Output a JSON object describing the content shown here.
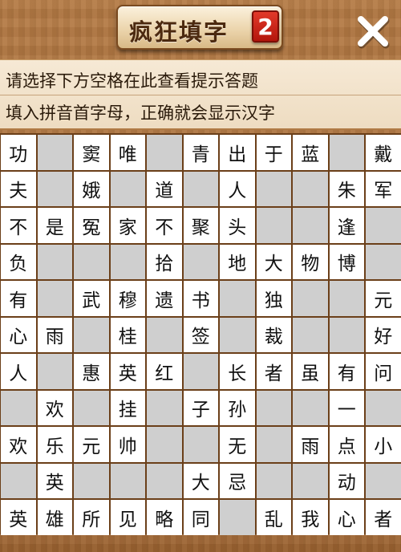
{
  "header": {
    "title": "疯狂填字",
    "level": "2",
    "close_icon": "close-x-icon"
  },
  "hint": {
    "line1": "请选择下方空格在此查看提示答题",
    "line2": "填入拼音首字母，正确就会显示汉字"
  },
  "colors": {
    "wood": "#a76d38",
    "panel": "#f3e4cc",
    "badge": "#d0281a",
    "empty_cell": "#cfcfcf",
    "filled_cell": "#ffffff"
  },
  "grid": {
    "rows": 11,
    "cols": 11,
    "cells": [
      [
        "功",
        "",
        "窦",
        "唯",
        "",
        "青",
        "出",
        "于",
        "蓝",
        "",
        "戴"
      ],
      [
        "夫",
        "",
        "娥",
        "",
        "道",
        "",
        "人",
        "",
        "",
        "朱",
        "军"
      ],
      [
        "不",
        "是",
        "冤",
        "家",
        "不",
        "聚",
        "头",
        "",
        "",
        "逢",
        ""
      ],
      [
        "负",
        "",
        "",
        "",
        "拾",
        "",
        "地",
        "大",
        "物",
        "博",
        ""
      ],
      [
        "有",
        "",
        "武",
        "穆",
        "遗",
        "书",
        "",
        "独",
        "",
        "",
        "元"
      ],
      [
        "心",
        "雨",
        "",
        "桂",
        "",
        "签",
        "",
        "裁",
        "",
        "",
        "好"
      ],
      [
        "人",
        "",
        "惠",
        "英",
        "红",
        "",
        "长",
        "者",
        "虽",
        "有",
        "问"
      ],
      [
        "",
        "欢",
        "",
        "挂",
        "",
        "子",
        "孙",
        "",
        "",
        "一",
        ""
      ],
      [
        "欢",
        "乐",
        "元",
        "帅",
        "",
        "",
        "无",
        "",
        "雨",
        "点",
        "小"
      ],
      [
        "",
        "英",
        "",
        "",
        "",
        "大",
        "忌",
        "",
        "",
        "动",
        ""
      ],
      [
        "英",
        "雄",
        "所",
        "见",
        "略",
        "同",
        "",
        "乱",
        "我",
        "心",
        "者"
      ]
    ]
  }
}
